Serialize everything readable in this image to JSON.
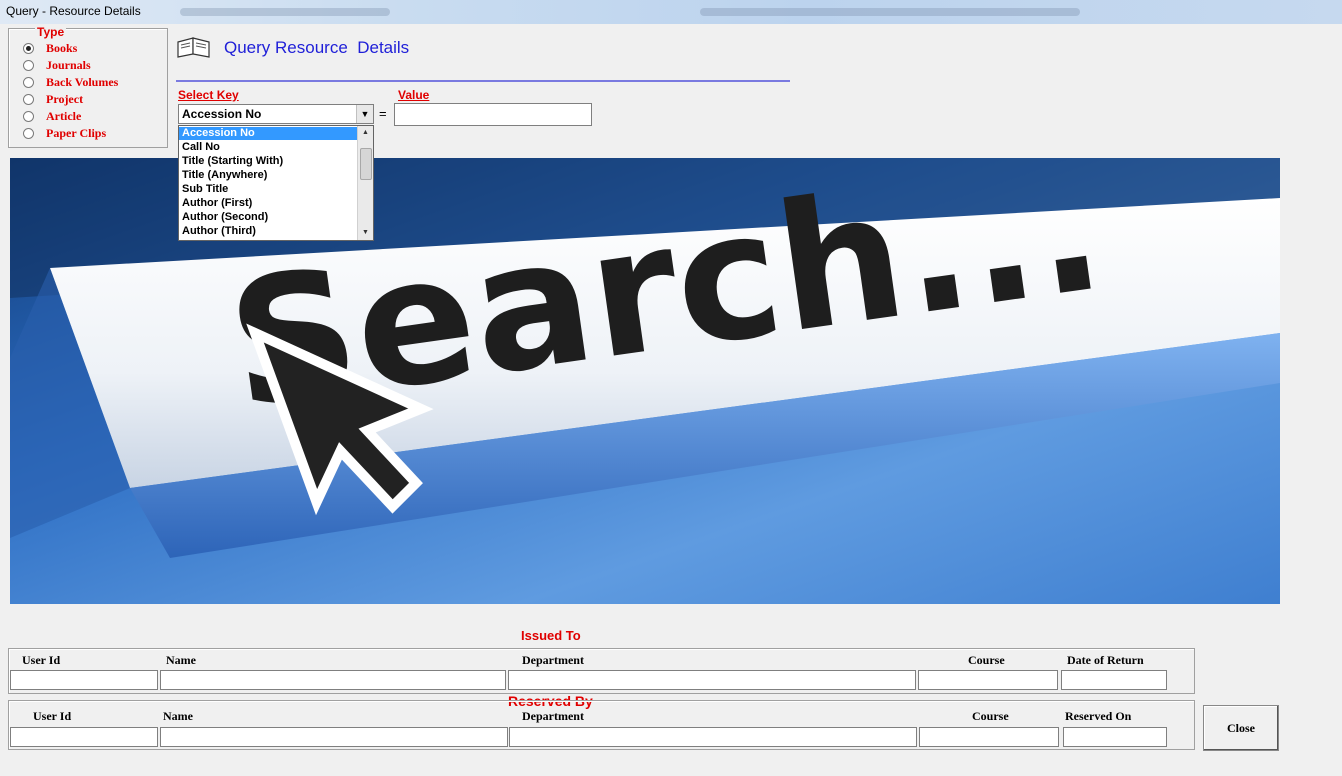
{
  "window": {
    "title": "Query - Resource Details"
  },
  "type_group": {
    "legend": "Type",
    "options": [
      {
        "label": "Books",
        "selected": true
      },
      {
        "label": "Journals",
        "selected": false
      },
      {
        "label": "Back Volumes",
        "selected": false
      },
      {
        "label": "Project",
        "selected": false
      },
      {
        "label": "Article",
        "selected": false
      },
      {
        "label": "Paper Clips",
        "selected": false
      }
    ]
  },
  "header": {
    "title": "Query Resource  Details",
    "icon": "book-icon"
  },
  "search": {
    "select_key_label": "Select Key",
    "value_label": "Value",
    "selected_key": "Accession No",
    "equals": "=",
    "value": "",
    "key_options": [
      "Accession No",
      "Call No",
      "Title (Starting With)",
      "Title (Anywhere)",
      "Sub Title",
      "Author (First)",
      "Author (Second)",
      "Author (Third)"
    ]
  },
  "banner": {
    "text": "Search..."
  },
  "issued_to": {
    "title": "Issued To",
    "columns": [
      "User Id",
      "Name",
      "Department",
      "Course",
      "Date of Return"
    ]
  },
  "reserved_by": {
    "title": "Reserved By",
    "columns": [
      "User Id",
      "Name",
      "Department",
      "Course",
      "Reserved On"
    ]
  },
  "close_button": {
    "label": "Close"
  }
}
